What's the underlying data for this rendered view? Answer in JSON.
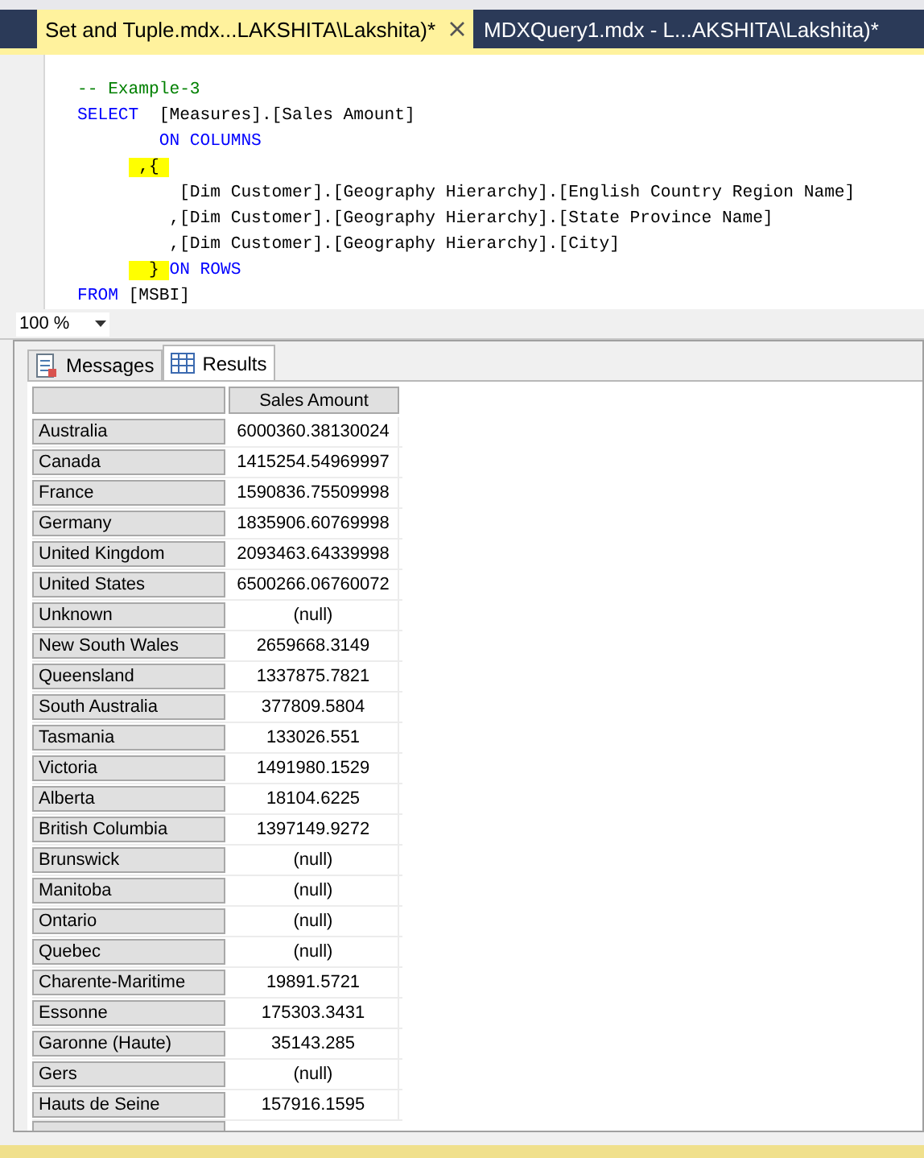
{
  "tabs": [
    {
      "label": "Set and Tuple.mdx...LAKSHITA\\Lakshita)*",
      "selected": true
    },
    {
      "label": "MDXQuery1.mdx - L...AKSHITA\\Lakshita)*",
      "selected": false
    }
  ],
  "editor": {
    "lines": [
      {
        "kind": "head",
        "segments": [
          {
            "text": "-- Example-3",
            "kind": "comment"
          }
        ]
      },
      {
        "kind": "head",
        "segments": [
          {
            "text": "SELECT",
            "kind": "keyword"
          },
          {
            "text": "  [Measures].[Sales Amount]",
            "kind": "text"
          }
        ]
      },
      {
        "kind": "clause",
        "segments": [
          {
            "text": "ON COLUMNS",
            "kind": "keyword"
          }
        ]
      },
      {
        "kind": "brace",
        "segments": [
          {
            "text": " ,{ ",
            "kind": "text",
            "highlight": true
          }
        ]
      },
      {
        "kind": "member",
        "segments": [
          {
            "text": " [Dim Customer].[Geography Hierarchy].[English Country Region Name]",
            "kind": "text"
          }
        ]
      },
      {
        "kind": "member",
        "segments": [
          {
            "text": ",[Dim Customer].[Geography Hierarchy].[State Province Name]",
            "kind": "text"
          }
        ]
      },
      {
        "kind": "member",
        "segments": [
          {
            "text": ",[Dim Customer].[Geography Hierarchy].[City]",
            "kind": "text"
          }
        ]
      },
      {
        "kind": "brace",
        "segments": [
          {
            "text": "  } ",
            "kind": "text",
            "highlight": true
          },
          {
            "text": "ON ROWS",
            "kind": "keyword"
          }
        ]
      },
      {
        "kind": "head",
        "segments": [
          {
            "text": "FROM",
            "kind": "keyword"
          },
          {
            "text": " [MSBI]",
            "kind": "text"
          }
        ]
      }
    ]
  },
  "zoom": {
    "value": "100 %"
  },
  "result_tabs": [
    {
      "label": "Messages",
      "selected": false
    },
    {
      "label": "Results",
      "selected": true
    }
  ],
  "grid": {
    "columns": [
      "Sales Amount"
    ],
    "rows": [
      {
        "member": "Australia",
        "value": "6000360.38130024"
      },
      {
        "member": "Canada",
        "value": "1415254.54969997"
      },
      {
        "member": "France",
        "value": "1590836.75509998"
      },
      {
        "member": "Germany",
        "value": "1835906.60769998"
      },
      {
        "member": "United Kingdom",
        "value": "2093463.64339998"
      },
      {
        "member": "United States",
        "value": "6500266.06760072"
      },
      {
        "member": "Unknown",
        "value": "(null)"
      },
      {
        "member": "New South Wales",
        "value": "2659668.3149"
      },
      {
        "member": "Queensland",
        "value": "1337875.7821"
      },
      {
        "member": "South Australia",
        "value": "377809.5804"
      },
      {
        "member": "Tasmania",
        "value": "133026.551"
      },
      {
        "member": "Victoria",
        "value": "1491980.1529"
      },
      {
        "member": "Alberta",
        "value": "18104.6225"
      },
      {
        "member": "British Columbia",
        "value": "1397149.9272"
      },
      {
        "member": "Brunswick",
        "value": "(null)"
      },
      {
        "member": "Manitoba",
        "value": "(null)"
      },
      {
        "member": "Ontario",
        "value": "(null)"
      },
      {
        "member": "Quebec",
        "value": "(null)"
      },
      {
        "member": "Charente-Maritime",
        "value": "19891.5721"
      },
      {
        "member": "Essonne",
        "value": "175303.3431"
      },
      {
        "member": "Garonne (Haute)",
        "value": "35143.285"
      },
      {
        "member": "Gers",
        "value": "(null)"
      },
      {
        "member": "Hauts de Seine",
        "value": "157916.1595"
      }
    ]
  }
}
